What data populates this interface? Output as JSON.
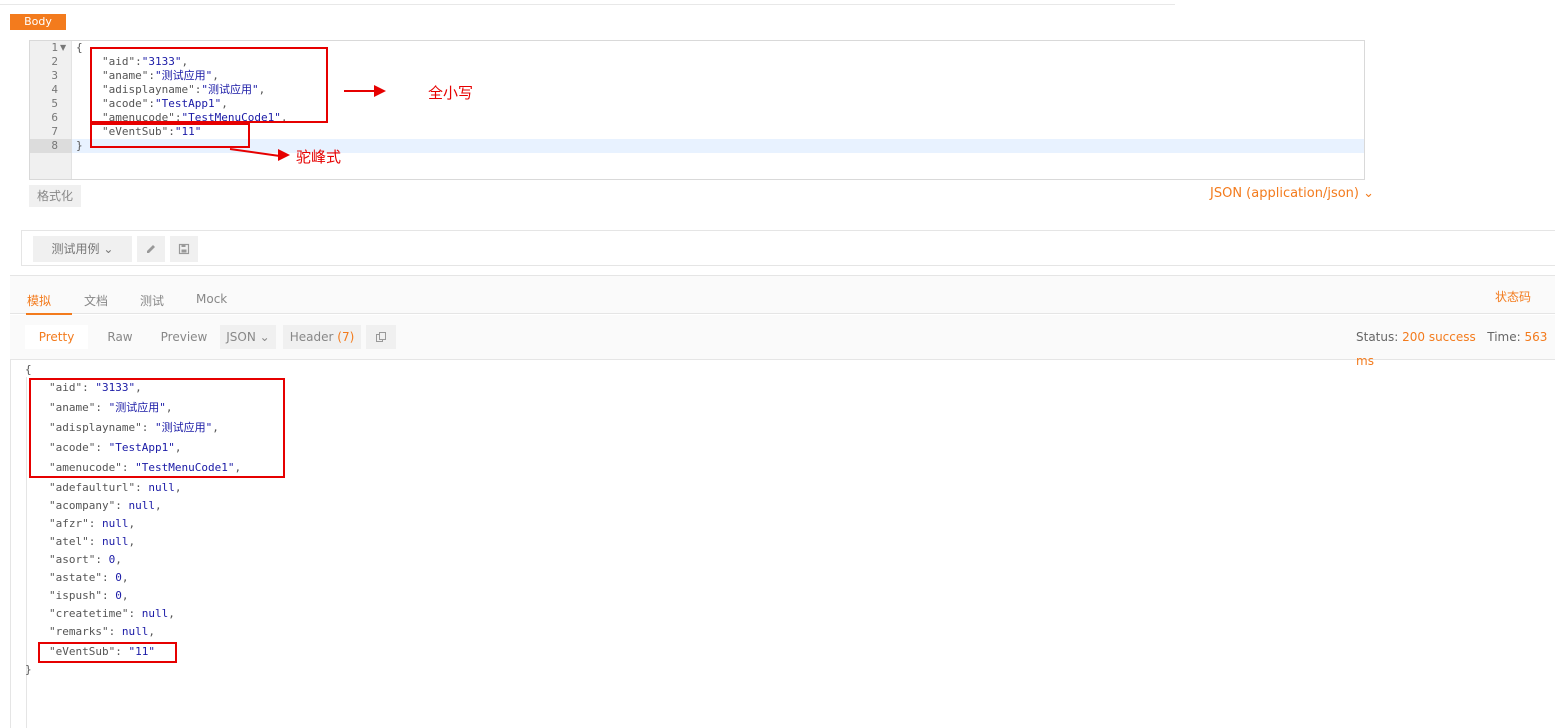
{
  "request": {
    "body_tab": "Body",
    "editor_lines": [
      {
        "num": "1",
        "text": "{"
      },
      {
        "num": "2",
        "key": "\"aid\"",
        "value": "\"3133\"",
        "tail": ","
      },
      {
        "num": "3",
        "key": "\"aname\"",
        "value": "\"测试应用\"",
        "tail": ","
      },
      {
        "num": "4",
        "key": "\"adisplayname\"",
        "value": "\"测试应用\"",
        "tail": ","
      },
      {
        "num": "5",
        "key": "\"acode\"",
        "value": "\"TestApp1\"",
        "tail": ","
      },
      {
        "num": "6",
        "key": "\"amenucode\"",
        "value": "\"TestMenuCode1\"",
        "tail": ","
      },
      {
        "num": "7",
        "key": "\"eVentSub\"",
        "value": "\"11\"",
        "tail": ""
      },
      {
        "num": "8",
        "text": "}"
      }
    ],
    "annotation_lowercase": "全小写",
    "annotation_camelcase": "驼峰式",
    "format_button": "格式化",
    "content_type": "JSON (application/json)",
    "testcase_button": "测试用例",
    "chevron": "⌄"
  },
  "response": {
    "tabs": [
      "模拟",
      "文档",
      "测试",
      "Mock"
    ],
    "status_code_link": "状态码",
    "view_buttons": {
      "pretty": "Pretty",
      "raw": "Raw",
      "preview": "Preview",
      "json": "JSON",
      "header": "Header",
      "header_count": "(7)"
    },
    "status_label": "Status:",
    "status_value": "200 success",
    "time_label": "Time:",
    "time_value": "563 ms",
    "body_lines": [
      {
        "text": "{"
      },
      {
        "key": "\"aid\"",
        "value": "\"3133\"",
        "tail": ","
      },
      {
        "key": "\"aname\"",
        "value": "\"测试应用\"",
        "tail": ","
      },
      {
        "key": "\"adisplayname\"",
        "value": "\"测试应用\"",
        "tail": ","
      },
      {
        "key": "\"acode\"",
        "value": "\"TestApp1\"",
        "tail": ","
      },
      {
        "key": "\"amenucode\"",
        "value": "\"TestMenuCode1\"",
        "tail": ","
      },
      {
        "key": "\"adefaulturl\"",
        "value": "null",
        "tail": ","
      },
      {
        "key": "\"acompany\"",
        "value": "null",
        "tail": ","
      },
      {
        "key": "\"afzr\"",
        "value": "null",
        "tail": ","
      },
      {
        "key": "\"atel\"",
        "value": "null",
        "tail": ","
      },
      {
        "key": "\"asort\"",
        "value": "0",
        "tail": ","
      },
      {
        "key": "\"astate\"",
        "value": "0",
        "tail": ","
      },
      {
        "key": "\"ispush\"",
        "value": "0",
        "tail": ","
      },
      {
        "key": "\"createtime\"",
        "value": "null",
        "tail": ","
      },
      {
        "key": "\"remarks\"",
        "value": "null",
        "tail": ","
      },
      {
        "key": "\"eVentSub\"",
        "value": "\"11\"",
        "tail": ""
      },
      {
        "text": "}"
      }
    ]
  },
  "colors": {
    "accent": "#f37b1d",
    "annotation": "#e60000",
    "string": "#1a1aa6"
  },
  "icons": [
    "fold-arrow-icon",
    "pencil-icon",
    "save-icon",
    "copy-icon",
    "chevron-down-icon",
    "arrow-right-icon"
  ]
}
